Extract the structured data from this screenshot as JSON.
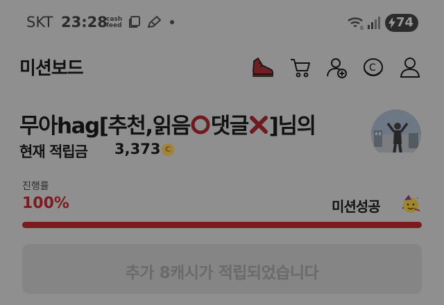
{
  "status_bar": {
    "carrier": "SKT",
    "time": "23:28",
    "cashfeed_line1": "cash",
    "cashfeed_line2": "feed",
    "battery": "74"
  },
  "header": {
    "title": "미션보드",
    "icons": [
      "shoe-icon",
      "cart-icon",
      "add-user-icon",
      "cash-coin-icon",
      "profile-icon"
    ]
  },
  "user": {
    "name_part1": "무아hag[추천,읽음",
    "name_part2": "댓글",
    "name_part3": "]님의",
    "balance_label": "현재 적립금",
    "balance_value": "3,373",
    "coin_symbol": "C"
  },
  "progress": {
    "label": "진행률",
    "value_text": "100%",
    "value": 100,
    "status": "미션성공"
  },
  "banner": {
    "text": "추가 8캐시가 적립되었습니다"
  },
  "colors": {
    "overlay_bg": "#8f8f8f",
    "accent": "#7c1a1f",
    "coin": "#a3823a"
  }
}
